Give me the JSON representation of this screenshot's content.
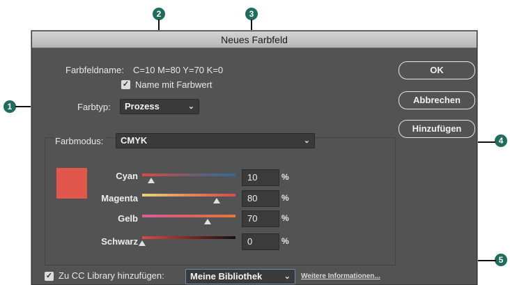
{
  "dialog": {
    "title": "Neues Farbfeld",
    "swatch_name_label": "Farbfeldname:",
    "swatch_name_value": "C=10 M=80 Y=70 K=0",
    "name_with_value_checkbox": {
      "label": "Name mit Farbwert",
      "checked": true
    },
    "color_type": {
      "label": "Farbtyp:",
      "value": "Prozess"
    },
    "color_mode": {
      "label": "Farbmodus:",
      "value": "CMYK"
    },
    "preview_color": "#e2574c",
    "sliders": [
      {
        "label": "Cyan",
        "value": "10",
        "unit": "%",
        "fraction": 0.1
      },
      {
        "label": "Magenta",
        "value": "80",
        "unit": "%",
        "fraction": 0.8
      },
      {
        "label": "Gelb",
        "value": "70",
        "unit": "%",
        "fraction": 0.7
      },
      {
        "label": "Schwarz",
        "value": "0",
        "unit": "%",
        "fraction": 0.0
      }
    ],
    "buttons": {
      "ok": "OK",
      "cancel": "Abbrechen",
      "add": "Hinzufügen"
    },
    "cc_library": {
      "checkbox_label": "Zu CC Library hinzufügen:",
      "checked": true,
      "library_value": "Meine Bibliothek",
      "more_info_link": "Weitere Informationen..."
    }
  },
  "callouts": [
    "1",
    "2",
    "3",
    "4",
    "5"
  ],
  "colors": {
    "callout": "#1f6d5c",
    "dialog_bg": "#535353"
  }
}
